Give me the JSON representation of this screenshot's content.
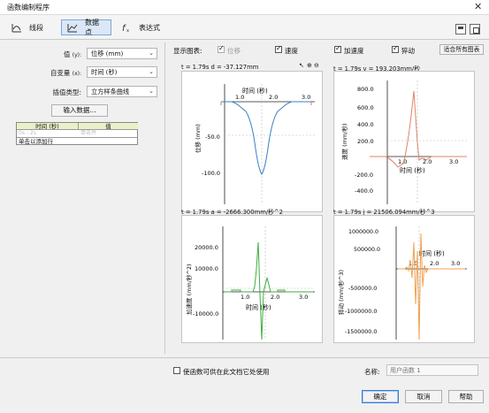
{
  "window": {
    "title": "函数编制程序",
    "close": "✕"
  },
  "tabs": [
    {
      "label": "线段",
      "icon": "segment-icon"
    },
    {
      "label": "数据点",
      "icon": "datapoint-icon"
    },
    {
      "label": "表达式",
      "icon": "function-icon"
    }
  ],
  "left": {
    "value_label": "值",
    "value_sub": "(y):",
    "value_combo": "位移 (mm)",
    "indep_label": "自变量",
    "indep_sub": "(x):",
    "indep_combo": "时间 (秒)",
    "interp_label": "插值类型:",
    "interp_combo": "立方样条曲线",
    "input_button": "输入数据...",
    "table": {
      "headers": [
        "时间 (秒)",
        "值"
      ],
      "placeholders": [
        "0s - 2s",
        "单击并"
      ],
      "add_row": "单击以添加行"
    }
  },
  "display": {
    "label": "显示图表:",
    "options": [
      {
        "label": "位移",
        "checked": true,
        "disabled": true
      },
      {
        "label": "速度",
        "checked": true,
        "disabled": false
      },
      {
        "label": "加速度",
        "checked": true,
        "disabled": false
      },
      {
        "label": "猝动",
        "checked": true,
        "disabled": false
      }
    ],
    "fit_button": "适合所有图表"
  },
  "plots": {
    "pos": {
      "stat": "t = 1.79s   d = -37.127mm",
      "ylabel": "位移 (mm)",
      "xlabel": "时间 (秒)",
      "ticks_x": [
        "1.0",
        "2.0",
        "3.0"
      ],
      "ticks_y": [
        "-50.0",
        "-100.0"
      ]
    },
    "vel": {
      "stat": "t = 1.79s   v = 193.203mm/秒",
      "ylabel": "速度 (mm/秒)",
      "xlabel": "时间 (秒)",
      "ticks_x": [
        "1.0",
        "2.0",
        "3.0"
      ],
      "ticks_y": [
        "800.0",
        "600.0",
        "400.0",
        "200.0",
        "-200.0",
        "-400.0"
      ]
    },
    "acc": {
      "stat": "t = 1.79s   a = -2666.300mm/秒^2",
      "ylabel": "加速度 (mm/秒^2)",
      "xlabel": "时间 (秒)",
      "ticks_x": [
        "1.0",
        "2.0",
        "3.0"
      ],
      "ticks_y": [
        "20000.0",
        "10000.0",
        "-10000.0"
      ]
    },
    "jerk": {
      "stat": "t = 1.79s   j = 21506.094mm/秒^3",
      "ylabel": "猝动 (mm/秒^3)",
      "xlabel": "时间 (秒)",
      "ticks_x": [
        "1.0",
        "2.0",
        "3.0"
      ],
      "ticks_y": [
        "1000000.0",
        "500000.0",
        "-500000.0",
        "-1000000.0",
        "-1500000.0"
      ]
    }
  },
  "footer": {
    "share_label": "使函数可供在此文档它处使用",
    "name_label": "名称:",
    "name_placeholder": "用户函数 1",
    "ok": "确定",
    "cancel": "取消",
    "help": "帮助"
  },
  "colors": {
    "pos": "#3b82c4",
    "vel": "#e0826a",
    "acc": "#3fae3f",
    "jerk": "#f0a050"
  }
}
